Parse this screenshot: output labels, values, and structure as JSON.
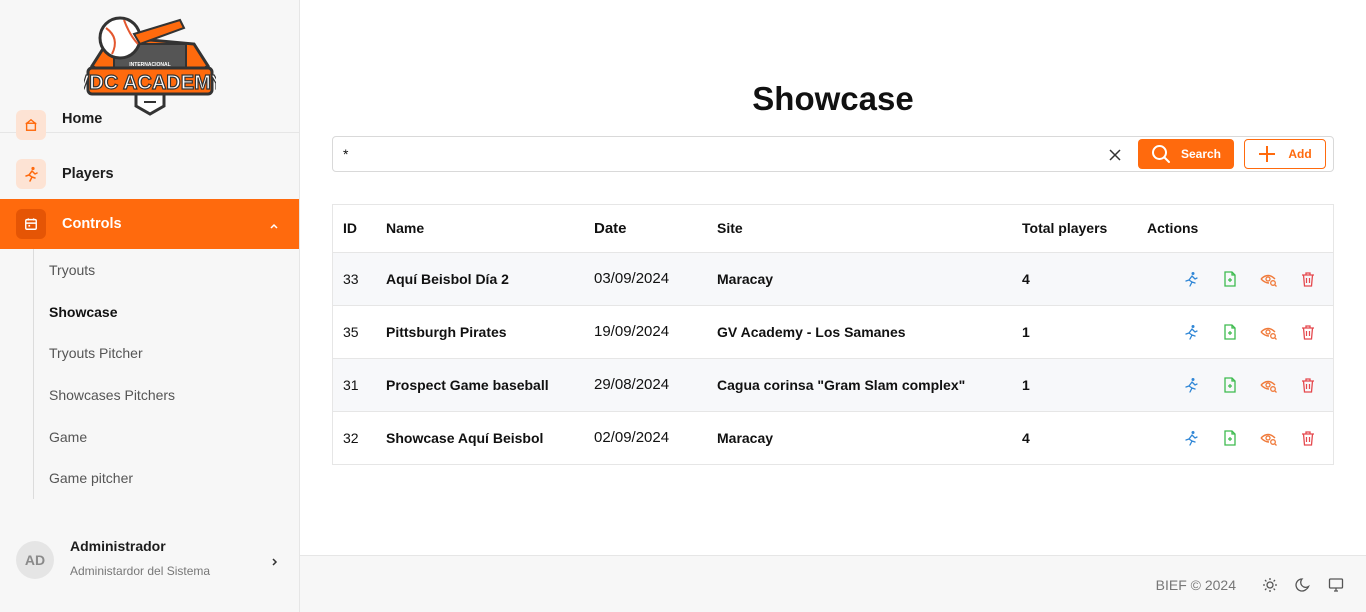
{
  "brand": {
    "logo_top": "INTERNACIONAL",
    "logo_text": "VDC ACADEMY"
  },
  "sidebar": {
    "items": [
      {
        "label": "Home",
        "icon": "home-icon"
      },
      {
        "label": "Players",
        "icon": "running-player-icon"
      },
      {
        "label": "Controls",
        "icon": "calendar-icon",
        "expanded": true
      }
    ],
    "submenu": [
      "Tryouts",
      "Showcase",
      "Tryouts Pitcher",
      "Showcases Pitchers",
      "Game",
      "Game pitcher"
    ],
    "current_submenu": "Showcase"
  },
  "user": {
    "initials": "AD",
    "name": "Administrador",
    "role": "Administardor del Sistema"
  },
  "page": {
    "title": "Showcase"
  },
  "search": {
    "value": "*",
    "search_label": "Search",
    "add_label": "Add"
  },
  "table": {
    "columns": [
      "ID",
      "Name",
      "Date",
      "Site",
      "Total players",
      "Actions"
    ],
    "rows": [
      {
        "id": "33",
        "name": "Aquí Beisbol Día 2",
        "date": "03/09/2024",
        "site": "Maracay",
        "total": "4"
      },
      {
        "id": "35",
        "name": "Pittsburgh Pirates",
        "date": "19/09/2024",
        "site": "GV Academy - Los Samanes",
        "total": "1"
      },
      {
        "id": "31",
        "name": "Prospect Game baseball",
        "date": "29/08/2024",
        "site": "Cagua corinsa \"Gram Slam complex\"",
        "total": "1"
      },
      {
        "id": "32",
        "name": "Showcase Aquí Beisbol",
        "date": "02/09/2024",
        "site": "Maracay",
        "total": "4"
      }
    ],
    "row_actions": [
      "players-icon",
      "document-icon",
      "view-icon",
      "delete-icon"
    ]
  },
  "footer": {
    "copyright": "BIEF © 2024",
    "icons": [
      "sun-icon",
      "moon-icon",
      "monitor-icon"
    ]
  },
  "colors": {
    "accent": "#ff6a0d",
    "blue": "#2f86d6",
    "green": "#3dbb4e",
    "orange": "#f07a3a",
    "red": "#e5484d"
  }
}
